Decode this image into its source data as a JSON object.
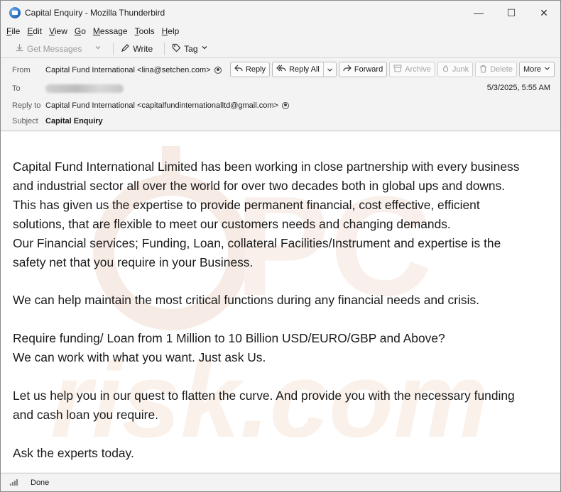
{
  "window": {
    "title": "Capital Enquiry - Mozilla Thunderbird",
    "controls": {
      "minimize": "—",
      "maximize": "☐",
      "close": "✕"
    }
  },
  "menu": {
    "items": [
      {
        "label": "File",
        "underline": "F",
        "rest": "ile"
      },
      {
        "label": "Edit",
        "underline": "E",
        "rest": "dit"
      },
      {
        "label": "View",
        "underline": "V",
        "rest": "iew"
      },
      {
        "label": "Go",
        "underline": "G",
        "rest": "o"
      },
      {
        "label": "Message",
        "underline": "M",
        "rest": "essage"
      },
      {
        "label": "Tools",
        "underline": "T",
        "rest": "ools"
      },
      {
        "label": "Help",
        "underline": "H",
        "rest": "elp"
      }
    ]
  },
  "toolbar": {
    "get_messages": "Get Messages",
    "write": "Write",
    "tag": "Tag"
  },
  "header": {
    "from_label": "From",
    "from_value": "Capital Fund International <lina@setchen.com>",
    "to_label": "To",
    "reply_to_label": "Reply to",
    "reply_to_value": "Capital Fund International <capitalfundinternationalltd@gmail.com>",
    "subject_label": "Subject",
    "subject_value": "Capital Enquiry",
    "date": "5/3/2025, 5:55 AM",
    "actions": {
      "reply": "Reply",
      "reply_all": "Reply All",
      "forward": "Forward",
      "archive": "Archive",
      "junk": "Junk",
      "delete": "Delete",
      "more": "More"
    }
  },
  "message": {
    "lines": [
      "Capital Fund International Limited has been working in close partnership with every business",
      "and industrial sector all over the world for over two decades both in global ups and downs.",
      "This has given us the expertise to provide permanent financial, cost effective, efficient",
      "solutions, that are flexible to meet our customers needs and changing demands.",
      "Our Financial services; Funding, Loan, collateral Facilities/Instrument and expertise is the",
      "safety net that you require in your Business.",
      "",
      "We can help maintain the most critical functions during any financial needs and crisis.",
      "",
      "Require funding/ Loan from 1 Million to 10 Billion USD/EURO/GBP and Above?",
      "We can work with what you want. Just ask Us.",
      "",
      "Let us help you in our quest to flatten the curve. And provide you with the necessary funding",
      "and cash loan you require.",
      "",
      "Ask the experts today."
    ]
  },
  "watermark": {
    "text": "risk.com"
  },
  "status": {
    "text": "Done"
  },
  "colors": {
    "accent": "#2b6fc2",
    "chrome": "#f3f3f3",
    "watermark": "#f7e6da"
  }
}
